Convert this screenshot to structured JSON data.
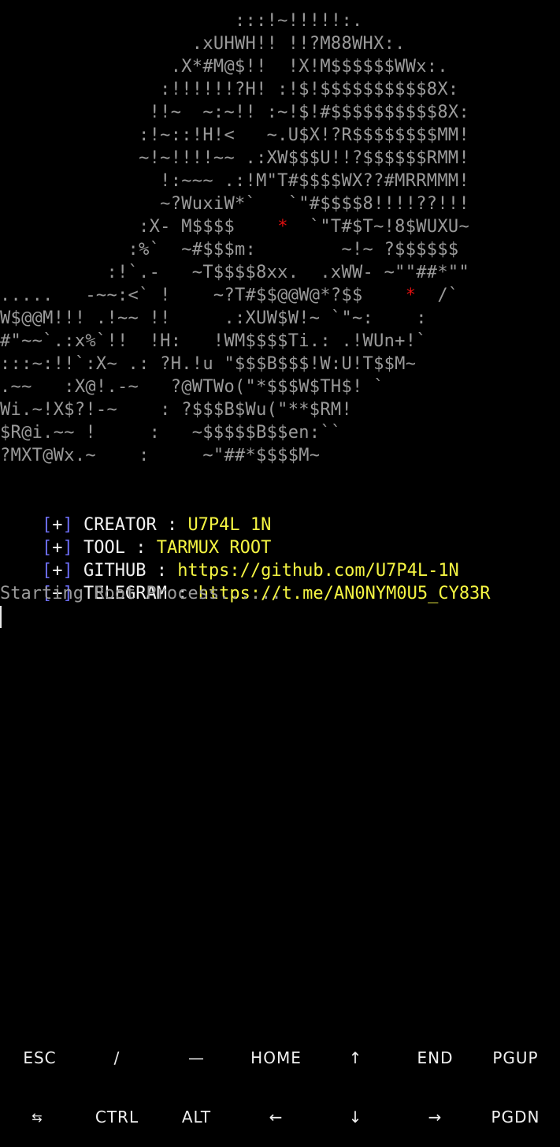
{
  "art_lines": [
    [
      {
        "t": "                      :::!~!!!!!:.",
        "c": "g"
      }
    ],
    [
      {
        "t": "                  .xUHWH!! !!?M88WHX:.",
        "c": "g"
      }
    ],
    [
      {
        "t": "                .X*#M@$!!  !X!M$$$$$$WWx:.",
        "c": "g"
      }
    ],
    [
      {
        "t": "               :!!!!!!?H! :!$!$$$$$$$$$$8X:",
        "c": "g"
      }
    ],
    [
      {
        "t": "              !!~  ~:~!! :~!$!#$$$$$$$$$$8X:",
        "c": "g"
      }
    ],
    [
      {
        "t": "             :!~::!H!<   ~.U$X!?R$$$$$$$$MM!",
        "c": "g"
      }
    ],
    [
      {
        "t": "             ~!~!!!!~~ .:XW$$$U!!?$$$$$$RMM!",
        "c": "g"
      }
    ],
    [
      {
        "t": "               !:~~~ .:!M\"T#$$$$WX??#MRRMMM!",
        "c": "g"
      }
    ],
    [
      {
        "t": "               ~?WuxiW*`   `\"#$$$$8!!!!??!!!",
        "c": "g"
      }
    ],
    [
      {
        "t": "             :X- M$$$$    ",
        "c": "g"
      },
      {
        "t": "*",
        "c": "r"
      },
      {
        "t": "  `\"T#$T~!8$WUXU~",
        "c": "g"
      }
    ],
    [
      {
        "t": "            :%`  ~#$$$m:        ~!~ ?$$$$$$",
        "c": "g"
      }
    ],
    [
      {
        "t": "          :!`.-   ~T$$$$8xx.  .xWW- ~\"\"##*\"\"",
        "c": "g"
      }
    ],
    [
      {
        "t": ".....   -~~:<` !    ~?T#$$@@W@*?$$    ",
        "c": "g"
      },
      {
        "t": "*",
        "c": "r"
      },
      {
        "t": "  /`",
        "c": "g"
      }
    ],
    [
      {
        "t": "W$@@M!!! .!~~ !!     .:XUW$W!~ `\"~:    :",
        "c": "g"
      }
    ],
    [
      {
        "t": "#\"~~`.:x%`!!  !H:   !WM$$$$Ti.: .!WUn+!`",
        "c": "g"
      }
    ],
    [
      {
        "t": ":::~:!!`:X~ .: ?H.!u \"$$$B$$$!W:U!T$$M~",
        "c": "g"
      }
    ],
    [
      {
        "t": ".~~   :X@!.-~   ?@WTWo(\"*$$$W$TH$! `",
        "c": "g"
      }
    ],
    [
      {
        "t": "Wi.~!X$?!-~    : ?$$$B$Wu(\"**$RM!",
        "c": "g"
      }
    ],
    [
      {
        "t": "$R@i.~~ !     :   ~$$$$$B$$en:``",
        "c": "g"
      }
    ],
    [
      {
        "t": "?MXT@Wx.~    :     ~\"##*$$$$M~",
        "c": "g"
      }
    ]
  ],
  "info": [
    {
      "prefix_open": "[",
      "prefix_mark": "+",
      "prefix_close": "]",
      "label": " CREATOR : ",
      "value": "U7P4L 1N"
    },
    {
      "prefix_open": "[",
      "prefix_mark": "+",
      "prefix_close": "]",
      "label": " TOOL : ",
      "value": "TARMUX ROOT"
    },
    {
      "prefix_open": "[",
      "prefix_mark": "+",
      "prefix_close": "]",
      "label": " GITHUB : ",
      "value": "https://github.com/U7P4L-1N"
    },
    {
      "prefix_open": "[",
      "prefix_mark": "+",
      "prefix_close": "]",
      "label": " TELEGRAM : ",
      "value": "https://t.me/AN0NYM0U5_CY83R"
    }
  ],
  "status": "Starting Root Process......",
  "colors": {
    "background": "#000000",
    "art_gray": "#9a9a9a",
    "star_red": "#e01010",
    "bracket_blue": "#6b6cf2",
    "value_yellow": "#f5f542",
    "text_white": "#f2f2f2"
  },
  "extra_keys": {
    "row1": [
      "ESC",
      "/",
      "—",
      "HOME",
      "↑",
      "END",
      "PGUP"
    ],
    "row2": [
      "⇆",
      "CTRL",
      "ALT",
      "←",
      "↓",
      "→",
      "PGDN"
    ]
  }
}
